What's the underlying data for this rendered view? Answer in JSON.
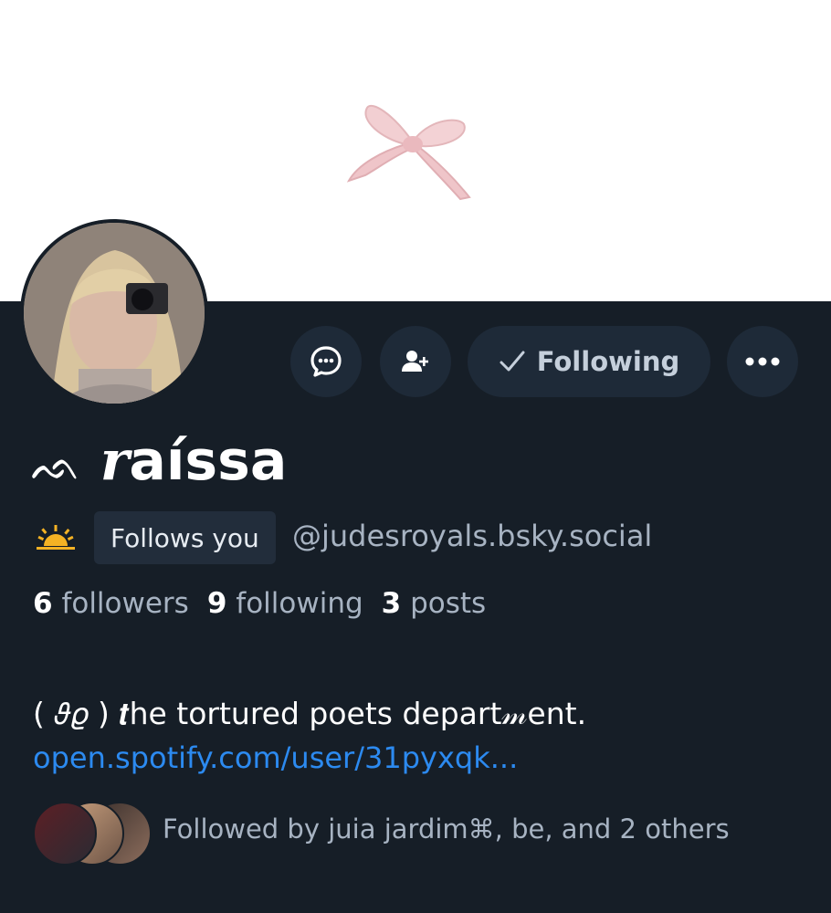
{
  "banner": {
    "image": "pink-bow"
  },
  "actions": {
    "message_icon": "chat-bubble-icon",
    "add_user_icon": "add-user-icon",
    "following_label": "Following",
    "more_icon": "more-dots-icon"
  },
  "profile": {
    "display_name_prefix": "ᨒ",
    "display_name_italic": "r",
    "display_name_rest": "aíssa",
    "badge_icon": "sunrise-icon",
    "follows_you": "Follows you",
    "handle": "@judesroyals.bsky.social",
    "stats": {
      "followers_count": "6",
      "followers_label": "followers",
      "following_count": "9",
      "following_label": "following",
      "posts_count": "3",
      "posts_label": "posts"
    },
    "bio_line": "( 𝜗𝜚 ) 𝒕he tortured poets depart𝓂ent.",
    "bio_link": "open.spotify.com/user/31pyxqk...",
    "followed_by": "Followed by juia jardim⌘, be, and 2 others"
  },
  "colors": {
    "background": "#161e27",
    "button_bg": "#1e2a38",
    "link": "#2c8af0",
    "muted_text": "#a7b3c2"
  }
}
